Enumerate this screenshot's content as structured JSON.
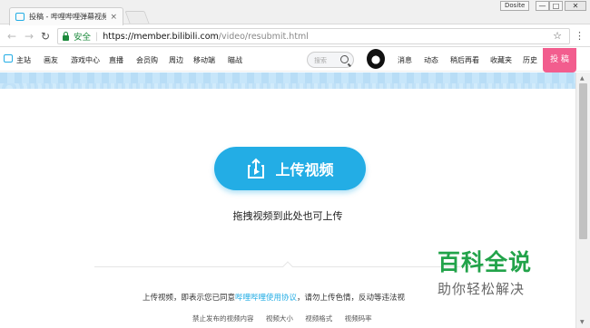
{
  "browser": {
    "tab_title": "投稿 - 哔哩哔哩弹幕视频",
    "tab_close": "×",
    "window_user": "Dosite",
    "window_buttons": [
      "—",
      "□",
      "✕"
    ],
    "secure_label": "安全",
    "url_host": "https://member.bilibili.com",
    "url_path": "/video/resubmit.html"
  },
  "site_nav": {
    "left_items": [
      "主站",
      "画友",
      "游戏中心",
      "直播",
      "会员购",
      "周边",
      "移动端",
      "瞄战"
    ],
    "search_placeholder": "搜索",
    "right_items": [
      "消息",
      "动态",
      "稍后再看",
      "收藏夹",
      "历史"
    ],
    "upload_tab": "投 稿"
  },
  "main": {
    "upload_button": "上传视频",
    "drag_hint": "拖拽视频到此处也可上传",
    "agreement_prefix": "上传视频，即表示您已同意",
    "agreement_link": "哔哩哔哩使用协议",
    "agreement_suffix": "，请勿上传色情，反动等违法视",
    "bottom_links": [
      "禁止发布的视频内容",
      "视频大小",
      "视频格式",
      "视频码率"
    ]
  },
  "watermark": {
    "title": "百科全说",
    "subtitle": "助你轻松解决"
  },
  "colors": {
    "accent": "#23ade5",
    "upload_tab": "#f25d8e",
    "secure": "#1c8a3c"
  }
}
